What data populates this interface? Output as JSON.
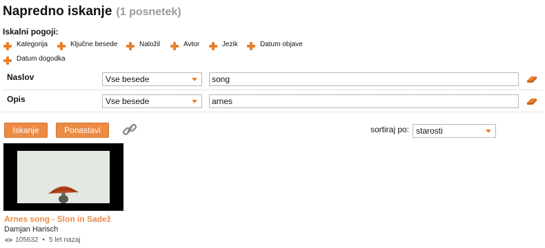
{
  "header": {
    "title": "Napredno iskanje",
    "count": "(1 posnetek)"
  },
  "criteria": {
    "label": "Iskalni pogoji:",
    "items": [
      {
        "label": "Kategorija",
        "icon": "plus-icon"
      },
      {
        "label": "Ključne besede",
        "icon": "plus-icon"
      },
      {
        "label": "Naložil",
        "icon": "plus-icon"
      },
      {
        "label": "Avtor",
        "icon": "plus-icon"
      },
      {
        "label": "Jezik",
        "icon": "plus-icon"
      },
      {
        "label": "Datum objave",
        "icon": "plus-icon"
      },
      {
        "label": "Datum dogodka",
        "icon": "plus-icon"
      }
    ]
  },
  "fields": [
    {
      "label": "Naslov",
      "mode": "Vse besede",
      "value": "song"
    },
    {
      "label": "Opis",
      "mode": "Vse besede",
      "value": "arnes"
    }
  ],
  "actions": {
    "search": "Iskanje",
    "reset": "Ponastavi"
  },
  "sort": {
    "label": "sortiraj po:",
    "value": "starosti"
  },
  "results": [
    {
      "title": "Arnes song - Slon in Sadež",
      "author": "Damjan Harisch",
      "views": "105632",
      "age": "5 let nazaj"
    }
  ],
  "colors": {
    "accent": "#ec8b44",
    "plus": "#e87f2c"
  }
}
